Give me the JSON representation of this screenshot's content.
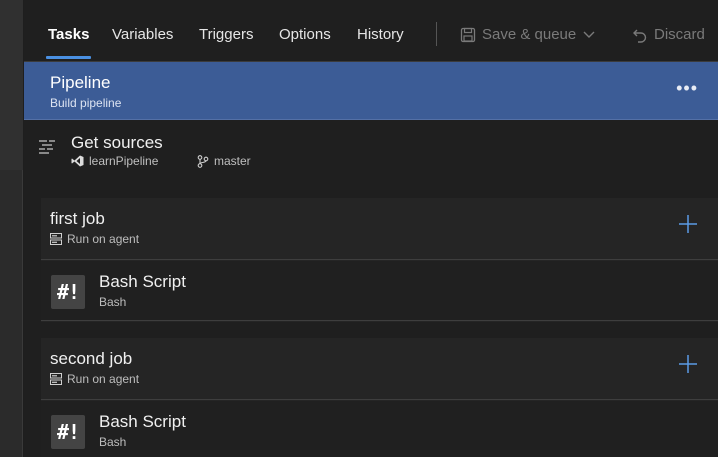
{
  "tabs": [
    {
      "label": "Tasks",
      "active": true
    },
    {
      "label": "Variables"
    },
    {
      "label": "Triggers"
    },
    {
      "label": "Options"
    },
    {
      "label": "History"
    }
  ],
  "toolbar": {
    "save_label": "Save & queue",
    "discard_label": "Discard"
  },
  "pipeline": {
    "title": "Pipeline",
    "subtitle": "Build pipeline",
    "more": "•••"
  },
  "sources": {
    "title": "Get sources",
    "repo": "learnPipeline",
    "branch": "master"
  },
  "jobs": [
    {
      "title": "first job",
      "subtitle": "Run on agent",
      "task": {
        "icon_text": "#!",
        "title": "Bash Script",
        "subtitle": "Bash"
      }
    },
    {
      "title": "second job",
      "subtitle": "Run on agent",
      "task": {
        "icon_text": "#!",
        "title": "Bash Script",
        "subtitle": "Bash"
      }
    }
  ],
  "colors": {
    "accent": "#4a90e2",
    "pipeline_bg": "#3c5c96"
  }
}
